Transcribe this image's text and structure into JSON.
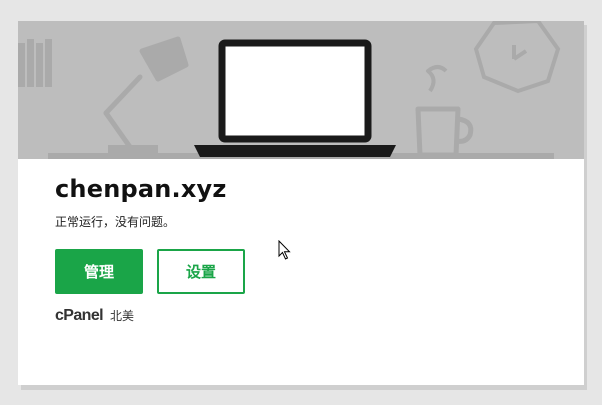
{
  "card": {
    "domain": "chenpan.xyz",
    "status": "正常运行，没有问题。",
    "manage_label": "管理",
    "settings_label": "设置",
    "brand": "cPanel",
    "region": "北美"
  },
  "colors": {
    "accent": "#1aa548",
    "banner_bg": "#bdbdbd",
    "illustration": "#aaaaaa",
    "laptop_outline": "#1a1a1a"
  },
  "icons": [
    "laptop-icon",
    "desk-lamp-icon",
    "books-icon",
    "wall-clock-icon",
    "coffee-mug-icon",
    "mouse-cursor-icon"
  ]
}
